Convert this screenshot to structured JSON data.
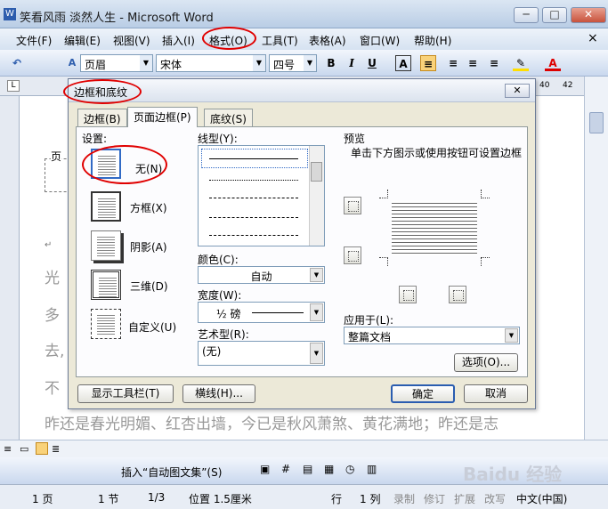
{
  "window": {
    "title": "笑看风雨 淡然人生 - Microsoft Word",
    "icon": "W",
    "min_label": "─",
    "max_label": "□",
    "close_label": "✕"
  },
  "menu": {
    "items": [
      "文件(F)",
      "编辑(E)",
      "视图(V)",
      "插入(I)",
      "格式(O)",
      "工具(T)",
      "表格(A)",
      "窗口(W)",
      "帮助(H)"
    ],
    "close": "×"
  },
  "toolbar": {
    "style_value": "页眉",
    "font_value": "宋体",
    "size_value": "四号",
    "bold": "B",
    "italic": "I",
    "underline": "U",
    "char_border": "A"
  },
  "ruler": {
    "left_mark": "L",
    "marks": [
      "40",
      "42"
    ]
  },
  "document": {
    "header_label": "页",
    "para_mark": "↵",
    "line_starts": [
      "光",
      "多",
      "去,",
      "不"
    ],
    "visible_line": "昨还是春光明媚、红杏出墙，今已是秋风萧煞、黄花满地；昨还是志"
  },
  "dialog": {
    "title": "边框和底纹",
    "close": "✕",
    "tabs": [
      "边框(B)",
      "页面边框(P)",
      "底纹(S)"
    ],
    "active_tab": 1,
    "settings_label": "设置:",
    "settings": [
      "无(N)",
      "方框(X)",
      "阴影(A)",
      "三维(D)",
      "自定义(U)"
    ],
    "line_style_label": "线型(Y):",
    "color_label": "颜色(C):",
    "color_value": "自动",
    "width_label": "宽度(W):",
    "width_value": "½ 磅",
    "art_label": "艺术型(R):",
    "art_value": "(无)",
    "preview_label": "预览",
    "preview_hint": "单击下方图示或使用按钮可设置边框",
    "apply_label": "应用于(L):",
    "apply_value": "整篇文档",
    "options_button": "选项(O)...",
    "toolbar_button": "显示工具栏(T)",
    "hline_button": "横线(H)...",
    "ok_button": "确定",
    "cancel_button": "取消"
  },
  "drawing_bar": {
    "insert_autotext": "插入“自动图文集”(S)"
  },
  "statusbar": {
    "page": "1 页",
    "section": "1 节",
    "fraction": "1/3",
    "position": "位置 1.5厘米",
    "line": "行",
    "column": "1 列",
    "rec": "录制",
    "trk": "修订",
    "ext": "扩展",
    "ovr": "改写",
    "lang": "中文(中国)"
  },
  "watermark": "Baidu 经验",
  "colors": {
    "highlight_ellipse": "#e00000",
    "title_bar": "#c9d8ee",
    "dialog_bg": "#ece9d8"
  }
}
